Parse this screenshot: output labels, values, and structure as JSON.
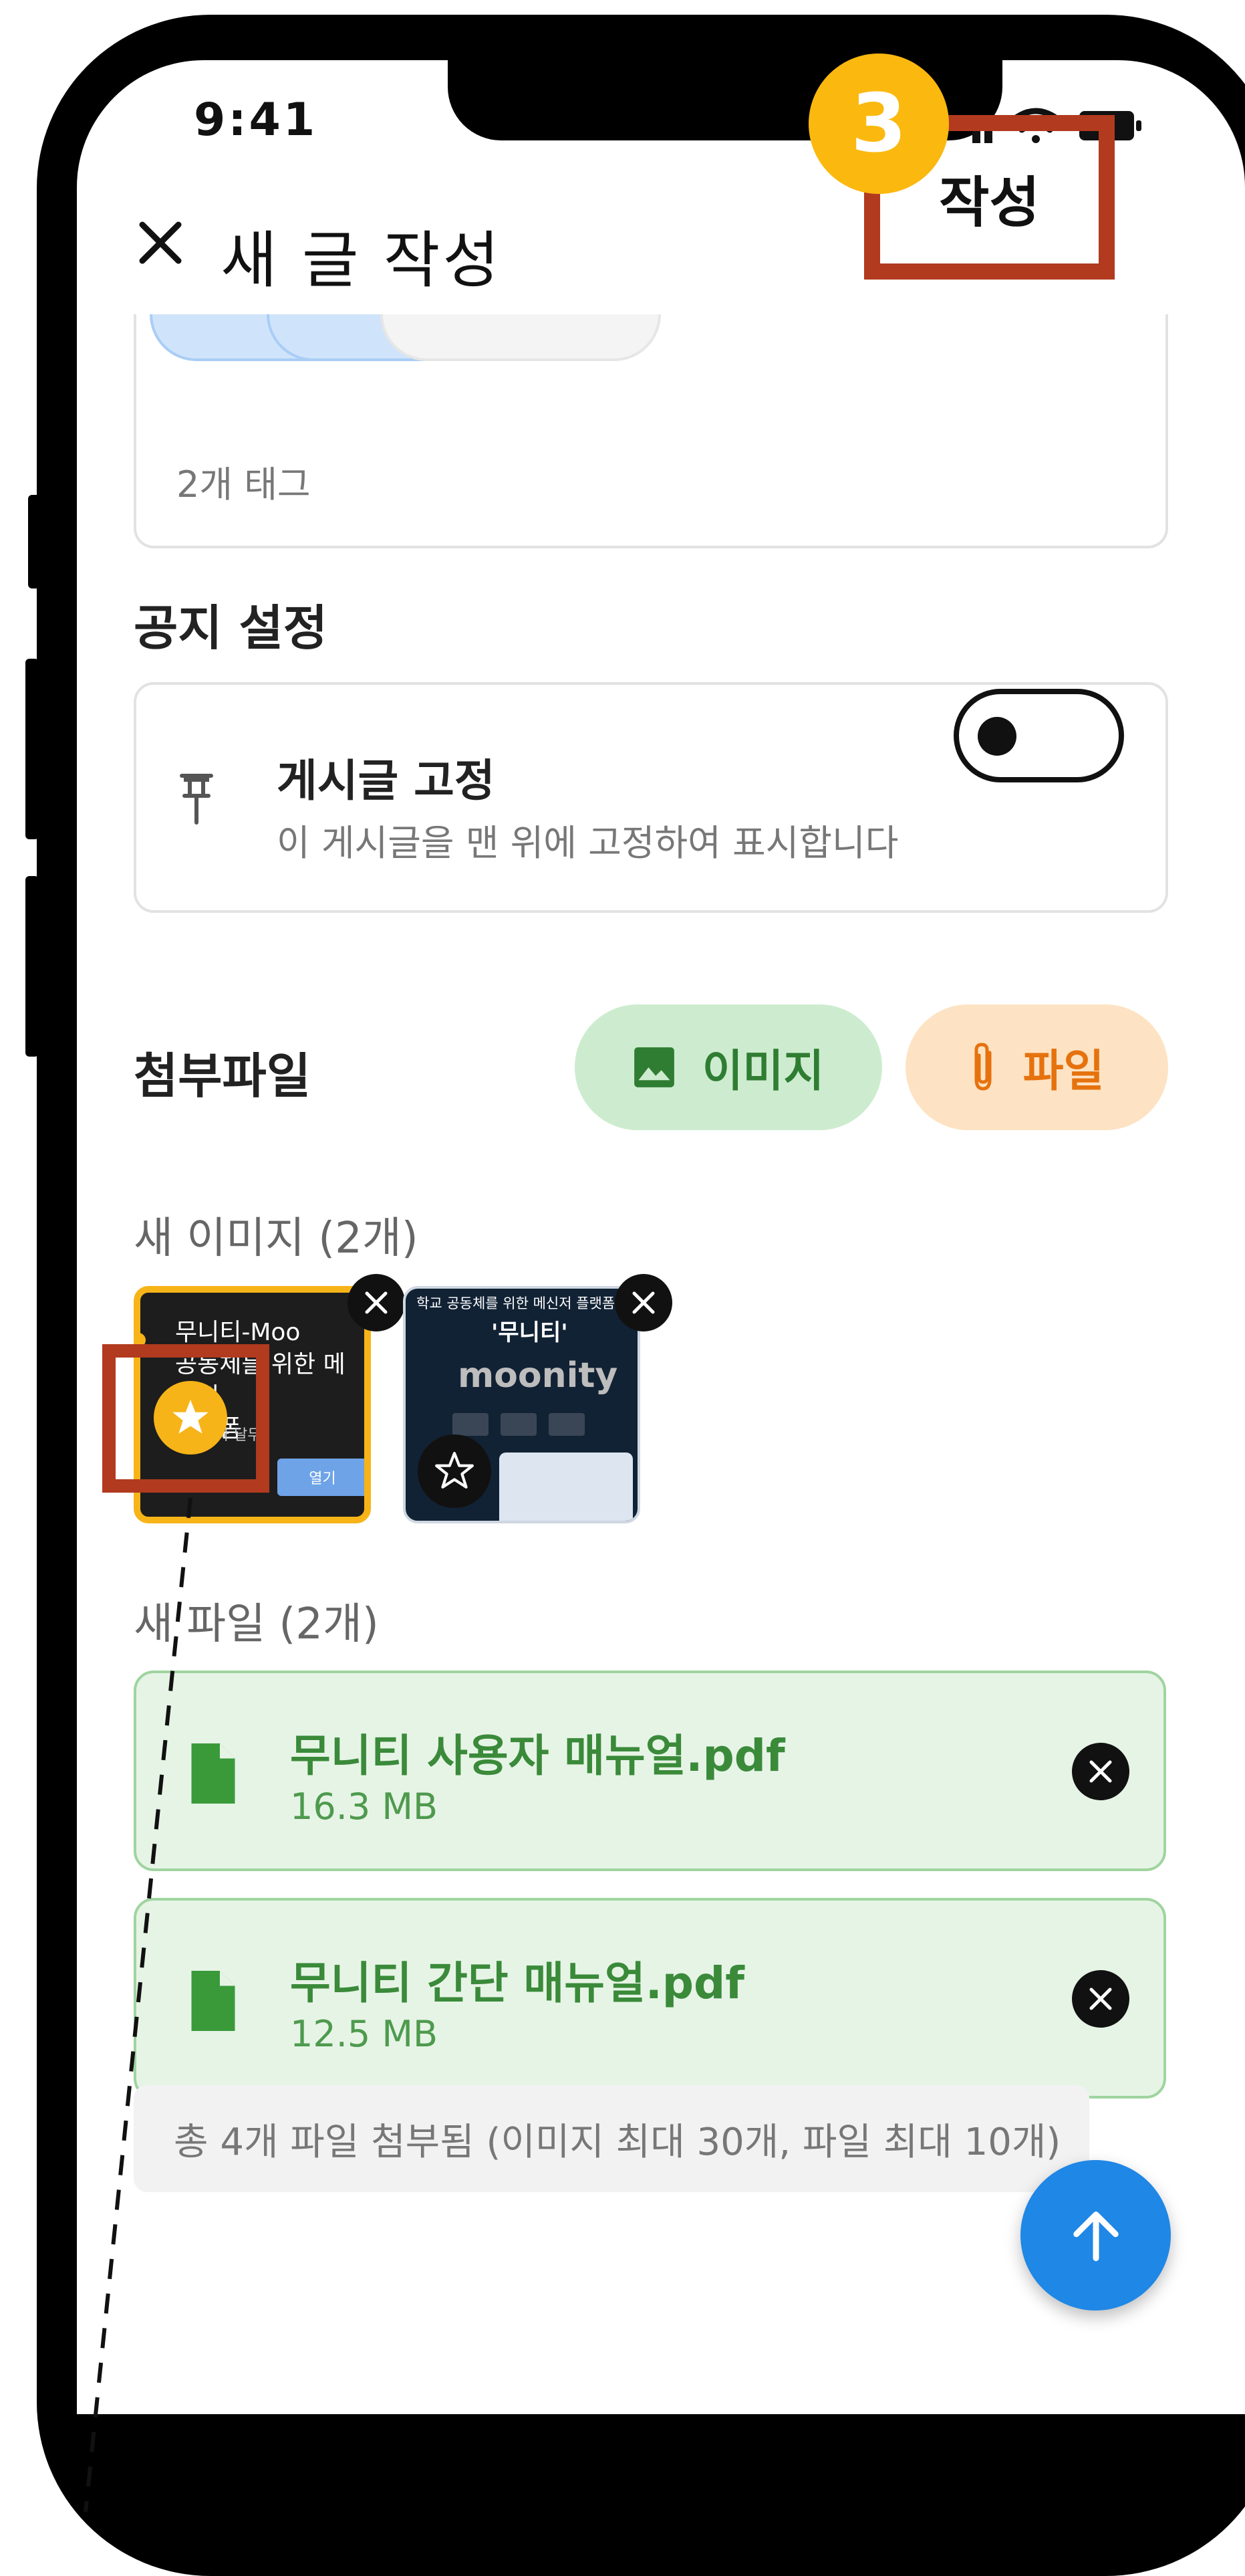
{
  "status_bar": {
    "time": "9:41"
  },
  "header": {
    "close_icon": "close-icon",
    "title": "새 글 작성",
    "submit_label": "작성",
    "step_badge": "3"
  },
  "tags": {
    "count_text": "2개 태그"
  },
  "notice": {
    "section_title": "공지 설정",
    "pin_icon": "pin-icon",
    "pin_title": "게시글 고정",
    "pin_description": "이 게시글을 맨 위에 고정하여 표시합니다",
    "pin_enabled": false
  },
  "attachments": {
    "section_title": "첨부파일",
    "image_button_label": "이미지",
    "file_button_label": "파일",
    "new_images_title": "새 이미지 (2개)",
    "images": [
      {
        "caption_lines": [
          "무니티-Moo",
          "공동체를 위한 메신저",
          "플랫폼"
        ],
        "small_text": "주식회사 달무",
        "button_text": "열기",
        "is_main": true
      },
      {
        "caption_top": "학교 공동체를 위한 메신저 플랫폼",
        "caption_title": "'무니티'",
        "logo_text": "moonity",
        "is_main": false
      }
    ],
    "new_files_title": "새 파일 (2개)",
    "files": [
      {
        "name": "무니티 사용자 매뉴얼.pdf",
        "size": "16.3 MB"
      },
      {
        "name": "무니티 간단 매뉴얼.pdf",
        "size": "12.5 MB"
      }
    ],
    "summary": "총 4개 파일 첨부됨 (이미지 최대 30개, 파일 최대 10개)"
  },
  "colors": {
    "highlight_box": "#b13a1f",
    "step_badge": "#fbb80f",
    "image_button_bg": "#cdeccf",
    "file_button_bg": "#fde3c3",
    "file_card_bg": "#e6f4e6",
    "fab": "#1f87e5"
  }
}
